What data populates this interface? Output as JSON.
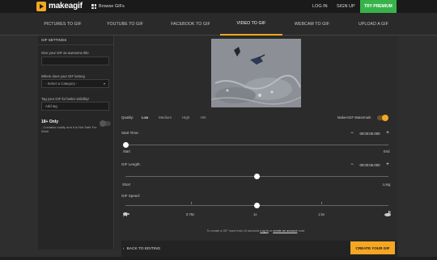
{
  "header": {
    "logo_text": "makeagif",
    "browse_label": "Browse GIFs",
    "login_label": "LOG IN",
    "signup_label": "SIGN UP",
    "premium_label": "TRY PREMIUM"
  },
  "tabs": [
    {
      "label": "PICTURES TO GIF",
      "active": false
    },
    {
      "label": "YOUTUBE TO GIF",
      "active": false
    },
    {
      "label": "FACEBOOK TO GIF",
      "active": false
    },
    {
      "label": "VIDEO TO GIF",
      "active": true
    },
    {
      "label": "WEBCAM TO GIF",
      "active": false
    },
    {
      "label": "UPLOAD A GIF",
      "active": false
    }
  ],
  "sidebar": {
    "heading": "GIF SETTINGS",
    "title_label": "Give your GIF an awesome title",
    "title_value": "",
    "category_label": "Where does your GIF belong",
    "category_value": "- Select a Category -",
    "tag_label": "Tag your GIF for better visibility!",
    "tag_placeholder": "Add tag",
    "adult_title": "18+ Only",
    "adult_sub": "- Contains nudity and it is Not Safe For Work",
    "adult_toggle_on": false
  },
  "main": {
    "quality_label": "Quality:",
    "quality_options": [
      "Low",
      "Medium",
      "High",
      "HD"
    ],
    "quality_selected": "Low",
    "watermark_label": "MakeAGIF Watermark",
    "watermark_on": true,
    "start_label": "Start Time:",
    "start_time": "00:00:00.000",
    "start_fraction": 0,
    "start_min_label": "Start",
    "start_max_label": "End",
    "length_label": "GIF Length:",
    "length_time": "00:00:05.000",
    "length_fraction": 0.5,
    "length_min_label": "Short",
    "length_max_label": "Long",
    "speed_label": "GIF Speed:",
    "speed_ticks": [
      "0.75x",
      "1x",
      "1.5x"
    ],
    "speed_fraction": 0.5,
    "footer_prefix": "To create a GIF more than 10 seconds",
    "footer_login": "Log in",
    "footer_mid": "or",
    "footer_create": "create an account",
    "footer_suffix": "now!",
    "back_label": "BACK TO EDITING",
    "create_label": "CREATE YOUR GIF"
  },
  "colors": {
    "accent": "#f5a623",
    "premium_green": "#37b34a",
    "background": "#2e2e2e"
  }
}
